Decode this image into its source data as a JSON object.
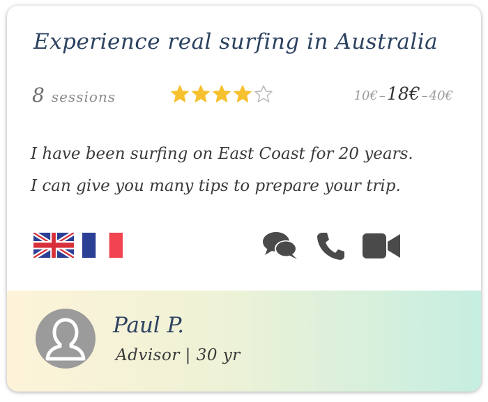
{
  "card": {
    "title": "Experience real surfing in Australia",
    "sessions": {
      "count": "8",
      "label": "sessions"
    },
    "rating": {
      "value": 4,
      "max": 5
    },
    "price": {
      "min": "10€",
      "dash1": "–",
      "main": "18€",
      "dash2": "–",
      "max": "40€"
    },
    "description": [
      "I have been surfing on East Coast for 20 years.",
      "I can give you many tips to prepare your trip."
    ],
    "languages": [
      "uk-flag",
      "france-flag"
    ],
    "contact_methods": [
      "chat-icon",
      "phone-icon",
      "video-icon"
    ],
    "colors": {
      "title": "#2c4260",
      "star_filled": "#f6c02e",
      "icon": "#4a4a4a",
      "footer_start": "#fdf3d9",
      "footer_end": "#c6eee1"
    }
  },
  "advisor": {
    "name": "Paul P.",
    "role": "Advisor | 30 yr"
  }
}
